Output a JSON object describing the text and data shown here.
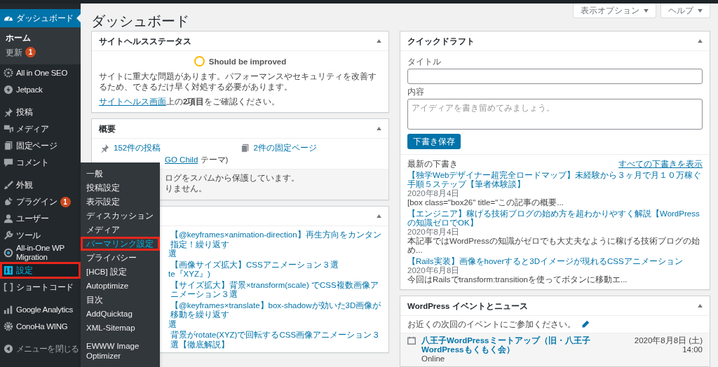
{
  "sidebar": {
    "groups": [
      {
        "items": [
          {
            "label": "ダッシュボード",
            "selected": true,
            "open": false,
            "annotated": false,
            "children": [
              {
                "label": "ホーム",
                "selected": true
              },
              {
                "label": "更新",
                "selected": false,
                "badge": "1"
              }
            ]
          },
          {
            "label": "All in One SEO",
            "selected": false,
            "open": false,
            "annotated": false
          },
          {
            "label": "Jetpack",
            "selected": false,
            "open": false,
            "annotated": false
          }
        ]
      },
      {
        "items": [
          {
            "label": "投稿",
            "selected": false,
            "open": false,
            "annotated": false
          },
          {
            "label": "メディア",
            "selected": false,
            "open": false,
            "annotated": false
          },
          {
            "label": "固定ページ",
            "selected": false,
            "open": false,
            "annotated": false
          },
          {
            "label": "コメント",
            "selected": false,
            "open": false,
            "annotated": false
          }
        ]
      },
      {
        "items": [
          {
            "label": "外観",
            "selected": false,
            "open": false,
            "annotated": false
          },
          {
            "label": "プラグイン",
            "selected": false,
            "open": false,
            "annotated": false,
            "badge": "1"
          },
          {
            "label": "ユーザー",
            "selected": false,
            "open": false,
            "annotated": false
          },
          {
            "label": "ツール",
            "selected": false,
            "open": false,
            "annotated": false
          },
          {
            "label": "All-in-One WP Migration",
            "selected": false,
            "open": false,
            "annotated": false
          },
          {
            "label": "設定",
            "selected": false,
            "open": true,
            "annotated": true
          },
          {
            "label": "ショートコード",
            "selected": false,
            "open": false,
            "annotated": false
          }
        ]
      },
      {
        "items": [
          {
            "label": "Google Analytics",
            "selected": false,
            "open": false,
            "annotated": false
          },
          {
            "label": "ConoHa WING",
            "selected": false,
            "open": false,
            "annotated": false
          }
        ]
      }
    ],
    "collapse": {
      "label": "メニューを閉じる"
    }
  },
  "flyout": {
    "items": [
      {
        "label": "一般",
        "selected": false,
        "annotated": false
      },
      {
        "label": "投稿設定",
        "selected": false,
        "annotated": false
      },
      {
        "label": "表示設定",
        "selected": false,
        "annotated": false
      },
      {
        "label": "ディスカッション",
        "selected": false,
        "annotated": false
      },
      {
        "label": "メディア",
        "selected": false,
        "annotated": false
      },
      {
        "label": "パーマリンク設定",
        "selected": true,
        "annotated": true
      },
      {
        "label": "プライバシー",
        "selected": false,
        "annotated": false
      },
      {
        "label": "[HCB] 設定",
        "selected": false,
        "annotated": false
      },
      {
        "label": "Autoptimize",
        "selected": false,
        "annotated": false
      },
      {
        "label": "目次",
        "selected": false,
        "annotated": false
      },
      {
        "label": "AddQuicktag",
        "selected": false,
        "annotated": false
      },
      {
        "label": "XML-Sitemap",
        "selected": false,
        "annotated": false
      },
      {
        "label": "EWWW Image Optimizer",
        "selected": false,
        "annotated": false
      }
    ]
  },
  "header": {
    "title": "ダッシュボード",
    "buttons": [
      "表示オプション",
      "ヘルプ"
    ]
  },
  "site_health": {
    "title": "サイトヘルスステータス",
    "status": "Should be improved",
    "description": "サイトに重大な問題があります。パフォーマンスやセキュリティを改善するため、できるだけ早く対処する必要があります。",
    "link": "サイトヘルス画面",
    "link_suffix": "上の**2項目**をご確認ください。"
  },
  "overview": {
    "title": "概要",
    "counts": [
      {
        "kind": "posts",
        "label": "152件の投稿"
      },
      {
        "kind": "pages",
        "label": "2件の固定ページ"
      }
    ],
    "theme_link": "GO Child",
    "theme_suffix": "テーマ)",
    "spam_lines": [
      "ログをスパムから保護しています。",
      "りません。"
    ]
  },
  "activity": {
    "items": [
      {
        "title": "【@keyframes×animation-direction】再生方向をカンタン指定！繰り返す",
        "continuation": "選"
      },
      {
        "title": "【画像サイズ拡大】CSSアニメーション３選",
        "continuation": "te『XYZ』)"
      },
      {
        "title": "【サイズ拡大】背景×transform(scale) でCSS複数画像アニメーション３選"
      },
      {
        "title": "【@keyframes×translate】box-shadowが効いた3D画像が移動を繰り返す",
        "continuation": "選"
      },
      {
        "title": "背景がrotate(XYZ)で回転するCSS画像アニメーション３選【徹底解説】"
      }
    ]
  },
  "quick_draft": {
    "title": "クイックドラフト",
    "title_label": "タイトル",
    "content_label": "内容",
    "content_placeholder": "アイディアを書き留めてみましょう。",
    "save_button": "下書き保存",
    "drafts_heading": "最新の下書き",
    "view_all": "すべての下書きを表示",
    "drafts": [
      {
        "title": "【独学Webデザイナー超完全ロードマップ】未経験から３ヶ月で月１０万稼ぐ手順５ステップ【筆者体験談】",
        "date": "2020年8月4日",
        "excerpt": "[box class=\"box26\" title=\"この記事の概要..."
      },
      {
        "title": "【エンジニア】稼げる技術ブログの始め方を超わかりやすく解説【WordPressの知識ゼロでOK】",
        "date": "2020年8月4日",
        "excerpt": "本記事ではWordPressの知識がゼロでも大丈夫なように稼げる技術ブログの始め..."
      },
      {
        "title": "【Rails実装】画像をhoverすると3Dイメージが現れるCSSアニメーション",
        "date": "2020年6月8日",
        "excerpt": "今回はRailsでtransform:transitionを使ってボタンに移動エ..."
      }
    ]
  },
  "events": {
    "title": "WordPress イベントとニュース",
    "intro": "お近くの次回のイベントにご参加ください。",
    "items": [
      {
        "name": "八王子WordPressミートアップ（旧・八王子WordPressもくもく会）",
        "location": "Online",
        "date": "2020年8月8日 (土)",
        "time": "14:00"
      }
    ]
  }
}
